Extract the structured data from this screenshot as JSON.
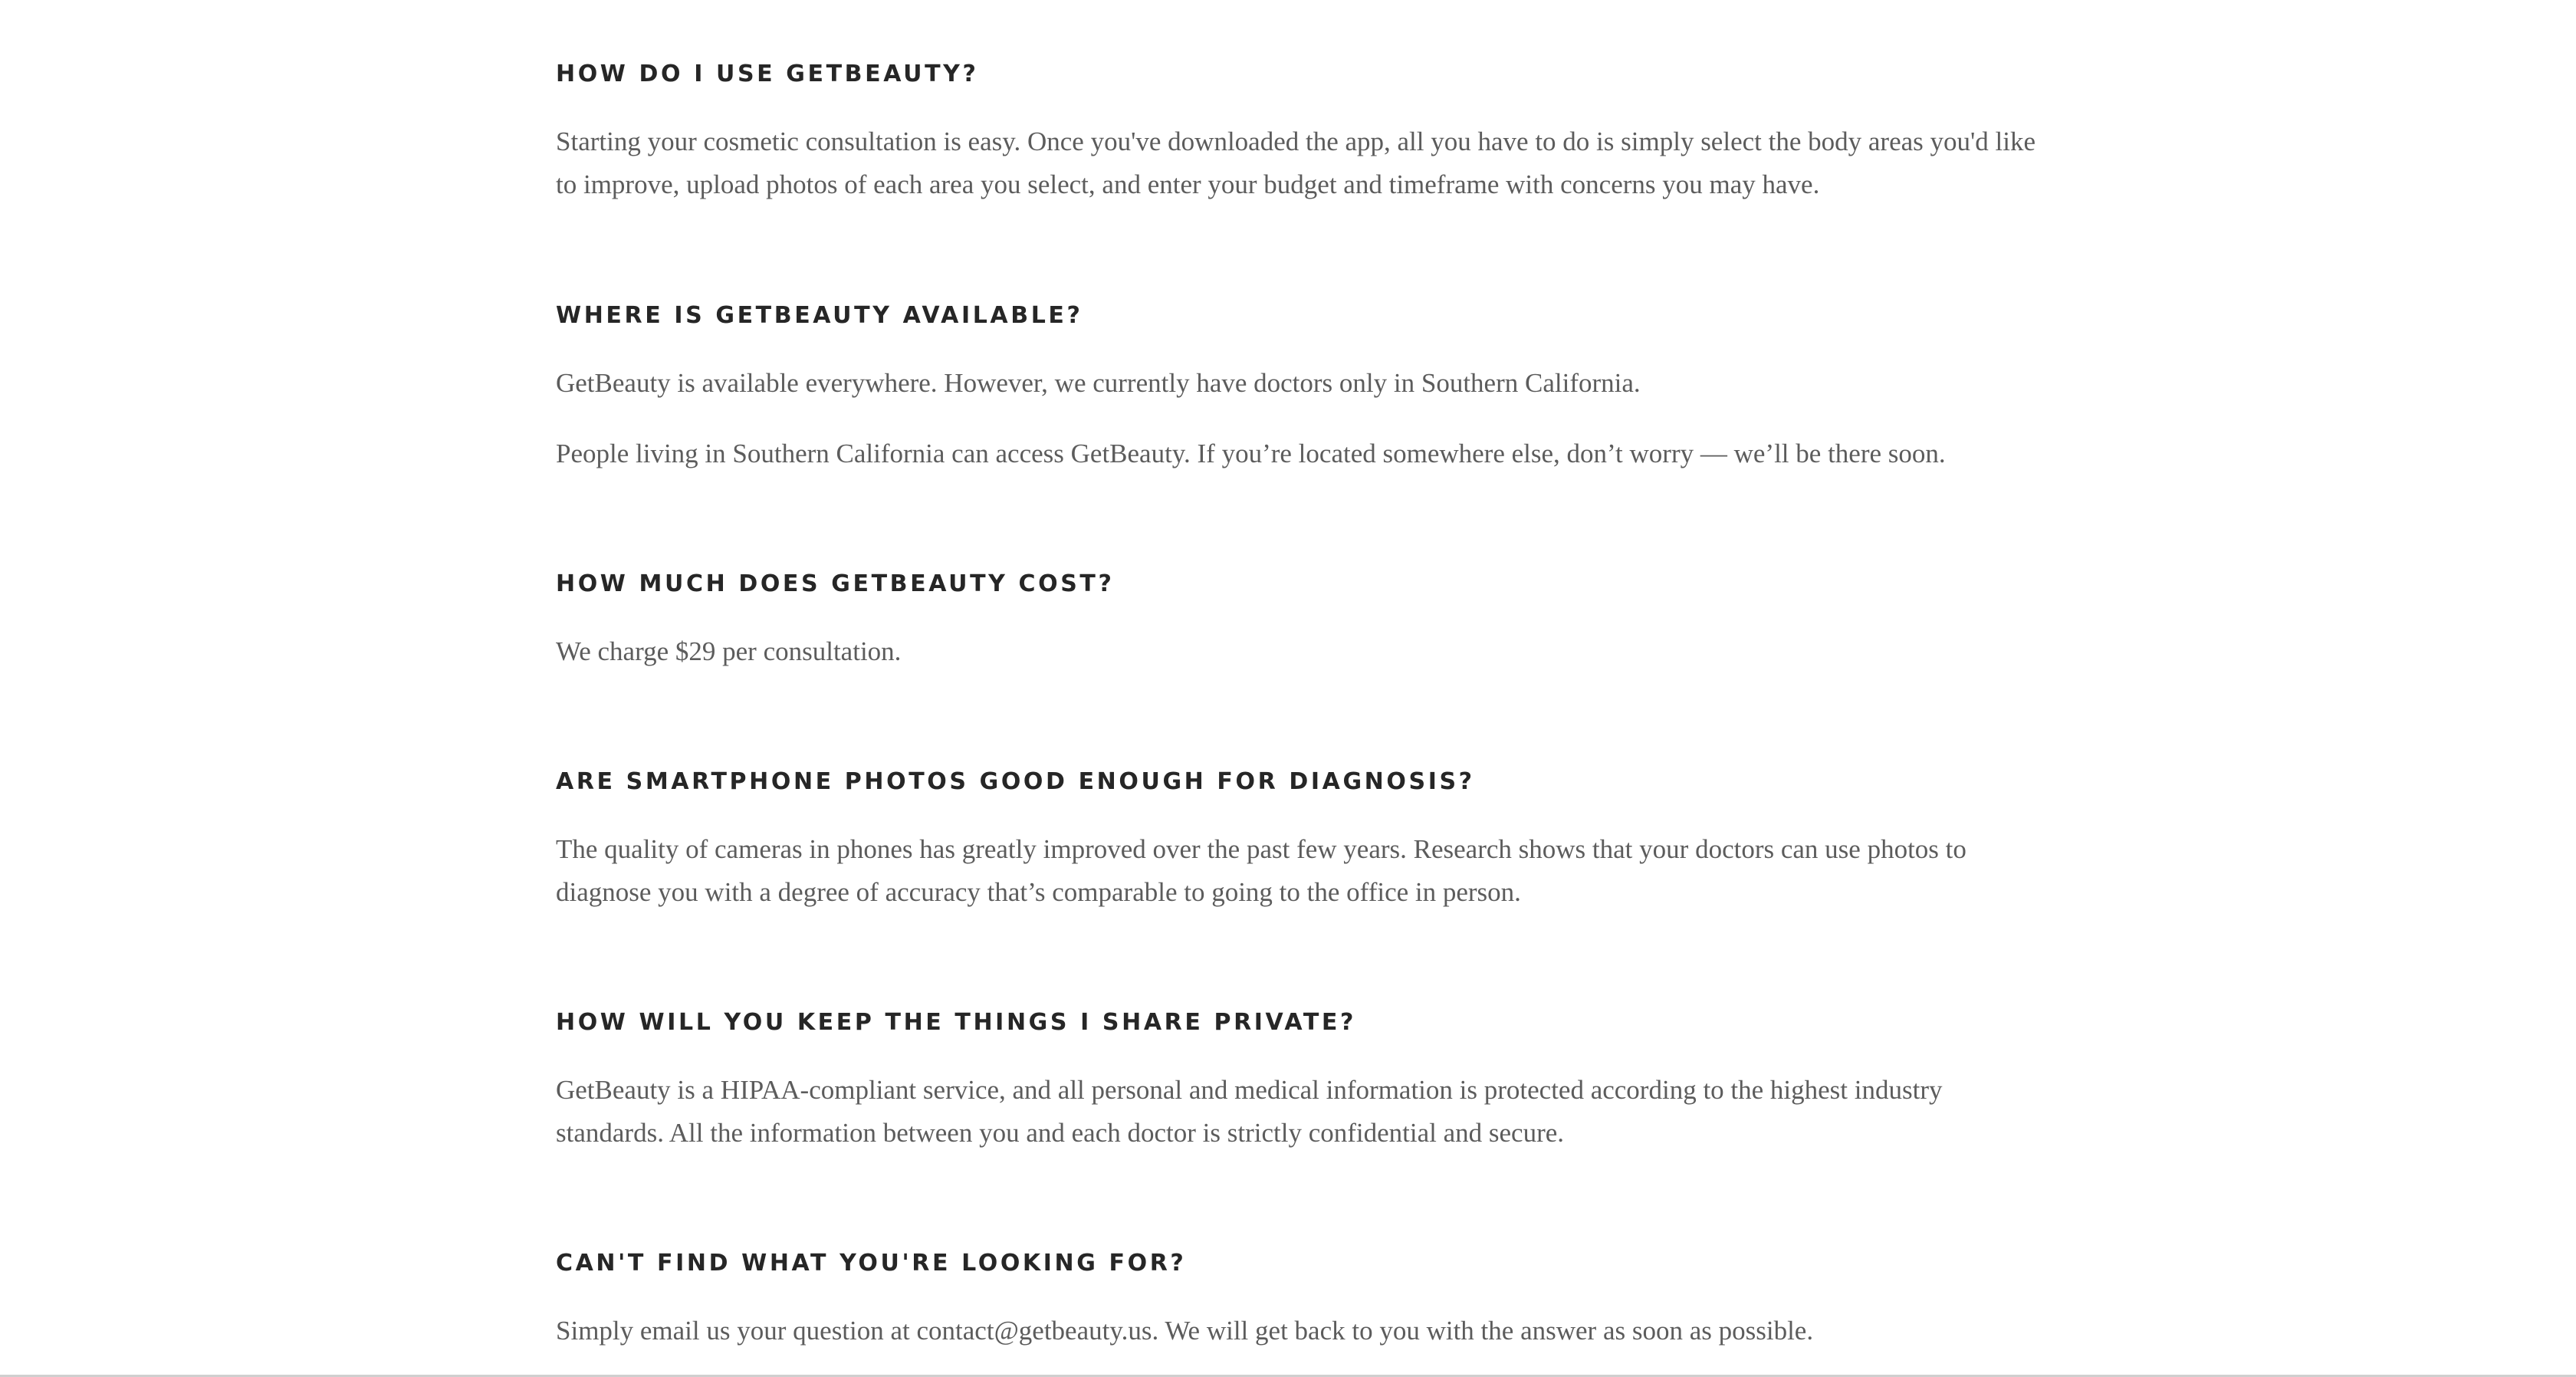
{
  "faq": [
    {
      "question": "HOW DO I USE GETBEAUTY?",
      "answers": [
        "Starting your cosmetic consultation is easy. Once you've downloaded the app, all you have to do is simply select the body areas you'd like\nto improve, upload photos of each area you select, and enter your budget and timeframe with concerns you may have."
      ]
    },
    {
      "question": "WHERE IS GETBEAUTY AVAILABLE?",
      "answers": [
        "GetBeauty is available everywhere. However, we currently have doctors only in Southern California.",
        "People living in Southern California can access GetBeauty. If you’re located somewhere else, don’t worry — we’ll be there soon."
      ]
    },
    {
      "question": "HOW MUCH DOES GETBEAUTY COST?",
      "answers": [
        "We charge $29 per consultation."
      ]
    },
    {
      "question": "ARE SMARTPHONE PHOTOS GOOD ENOUGH FOR DIAGNOSIS?",
      "answers": [
        "The quality of cameras in phones has greatly improved over the past few years. Research shows that your doctors can use photos to\ndiagnose you with a degree of accuracy that’s comparable to going to the office in person."
      ]
    },
    {
      "question": "HOW WILL YOU KEEP THE THINGS I SHARE PRIVATE?",
      "answers": [
        "GetBeauty is a HIPAA-compliant service, and all personal and medical information is protected according to the highest industry\nstandards. All the information between you and each doctor is strictly confidential and secure."
      ]
    },
    {
      "question": "CAN'T FIND WHAT YOU'RE LOOKING FOR?",
      "answers": [
        "Simply email us your question at contact@getbeauty.us. We will get back to you with the answer as soon as possible."
      ]
    }
  ]
}
